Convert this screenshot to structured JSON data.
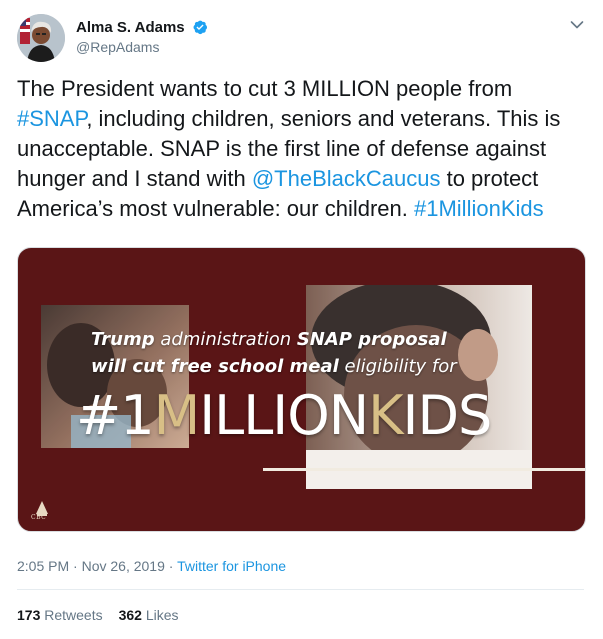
{
  "author": {
    "display_name": "Alma S. Adams",
    "handle": "@RepAdams",
    "verified_icon": "verified-badge-icon"
  },
  "menu_icon": "chevron-down-icon",
  "tweet": {
    "text_before_snap": "The President wants to cut 3 MILLION people from ",
    "hashtag_snap": "#SNAP",
    "text_middle": ", including children, seniors and veterans. This is unacceptable. SNAP is the first line of defense against hunger and I stand with ",
    "mention": "@TheBlackCaucus",
    "text_after_mention": " to protect America’s most vulnerable: our children. ",
    "hashtag_kids": "#1MillionKids"
  },
  "media": {
    "headline_line1_a": "Trump",
    "headline_line1_b": " administration ",
    "headline_line1_c": "SNAP proposal",
    "headline_line2_a": "will cut free school meal",
    "headline_line2_b": " eligibility for",
    "big_hash_1": "#1",
    "big_M": "M",
    "big_illion": "ILLION",
    "big_K": "K",
    "big_ids": "IDS",
    "logo_text": "CBC",
    "background_color": "#5a1516",
    "accent_color": "#d8bf86"
  },
  "meta": {
    "time": "2:05 PM",
    "separator": " · ",
    "date": "Nov 26, 2019",
    "separator2": " · ",
    "source": "Twitter for iPhone"
  },
  "stats": {
    "retweets_count": "173",
    "retweets_label": "Retweets",
    "likes_count": "362",
    "likes_label": "Likes"
  },
  "colors": {
    "link": "#1b95e0",
    "secondary_text": "#657786",
    "primary_text": "#14171a"
  }
}
